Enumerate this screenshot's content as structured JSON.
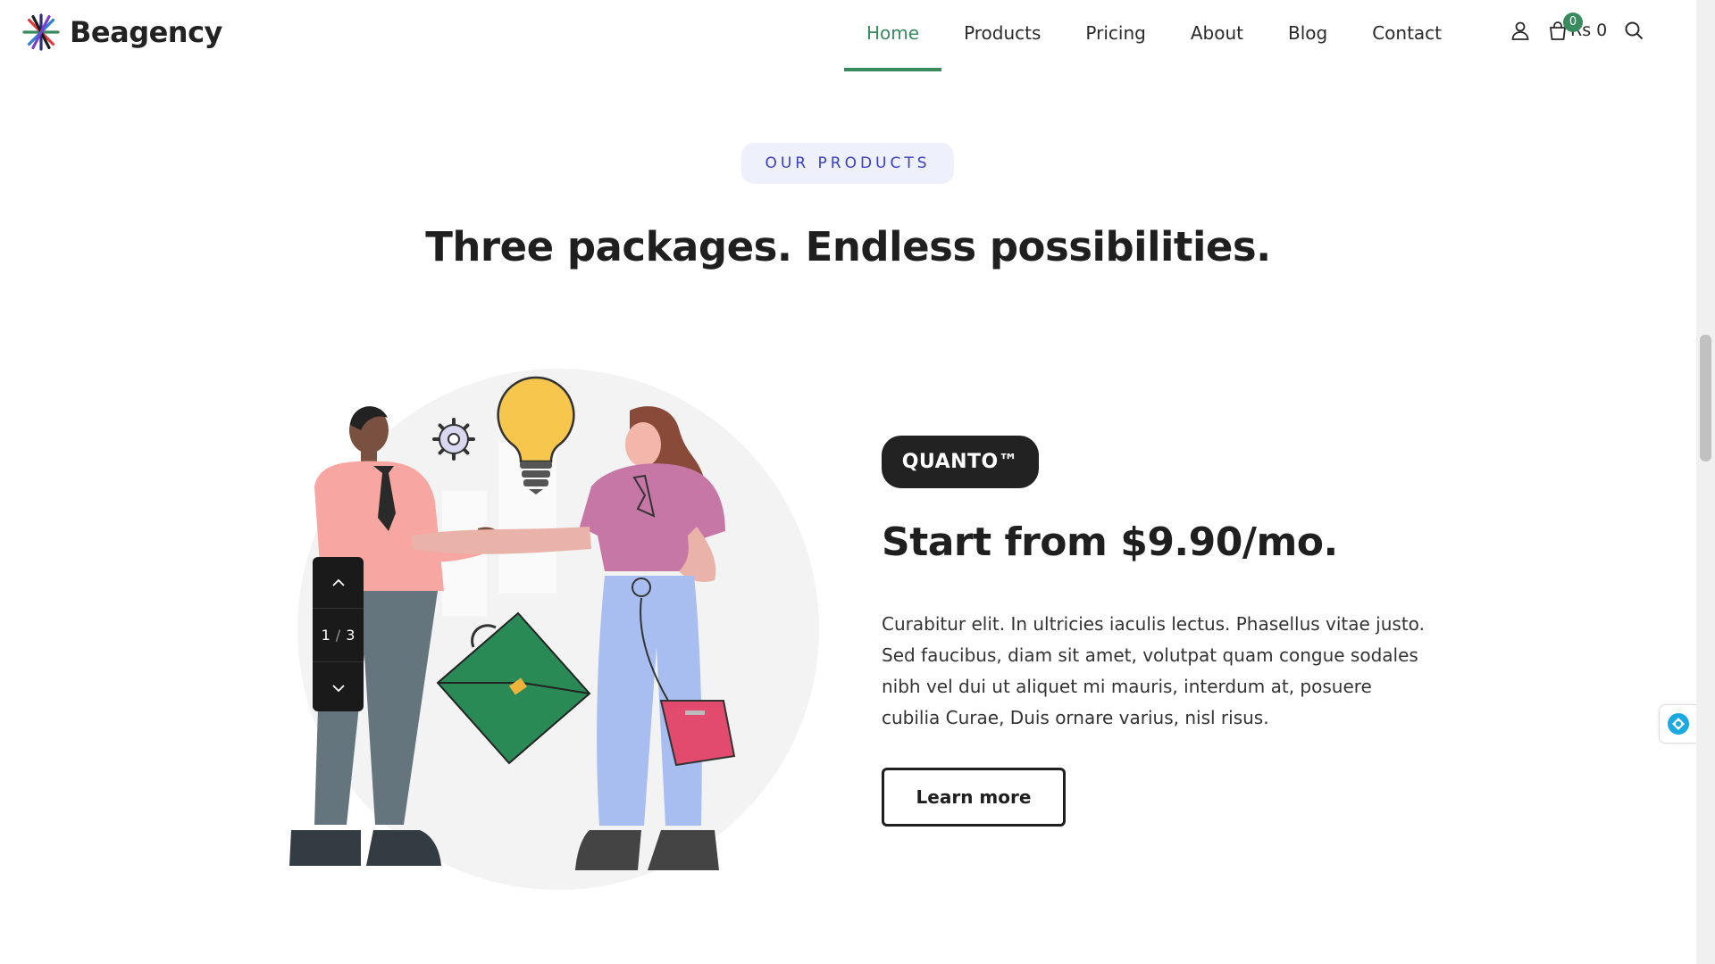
{
  "brand": {
    "name": "Beagency"
  },
  "nav": {
    "items": [
      {
        "label": "Home",
        "active": true
      },
      {
        "label": "Products"
      },
      {
        "label": "Pricing"
      },
      {
        "label": "About"
      },
      {
        "label": "Blog"
      },
      {
        "label": "Contact"
      }
    ]
  },
  "header_tools": {
    "account_icon": "user-icon",
    "cart_icon": "shopping-bag-icon",
    "cart_count": "0",
    "cart_total": "Rs 0",
    "search_icon": "search-icon"
  },
  "section": {
    "eyebrow": "OUR PRODUCTS",
    "heading": "Three packages. Endless possibilities."
  },
  "slider": {
    "current": "1",
    "separator": "/",
    "total": "3",
    "prev_icon": "chevron-up-icon",
    "next_icon": "chevron-down-icon"
  },
  "product": {
    "badge": "QUANTO™",
    "title": "Start from $9.90/mo.",
    "description": "Curabitur elit. In ultricies iaculis lectus. Phasellus vitae justo. Sed faucibus, diam sit amet, volutpat quam congue sodales nibh vel dui ut aliquet mi mauris, interdum at, posuere cubilia Curae, Duis ornare varius, nisl risus.",
    "cta": "Learn more"
  },
  "colors": {
    "accent": "#3a8a5f",
    "eyebrow_text": "#3b3fc2",
    "eyebrow_bg": "#eef0fb",
    "dark": "#1f1f1f"
  }
}
